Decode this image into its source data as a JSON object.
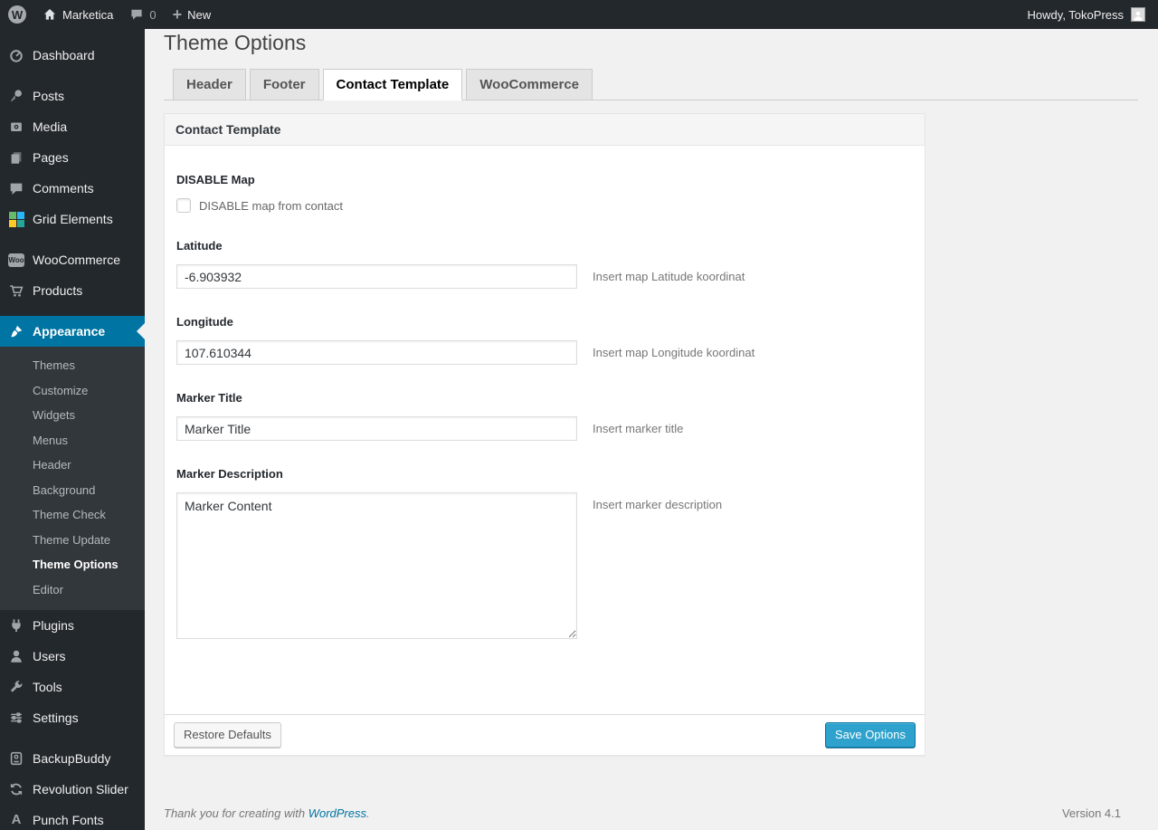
{
  "admin_bar": {
    "site_name": "Marketica",
    "comments_count": "0",
    "new_label": "New",
    "howdy": "Howdy, TokoPress"
  },
  "sidebar": {
    "items": [
      {
        "label": "Dashboard",
        "icon": "dashboard-icon"
      },
      {
        "label": "Posts",
        "icon": "pushpin-icon",
        "separator_before": true
      },
      {
        "label": "Media",
        "icon": "media-icon"
      },
      {
        "label": "Pages",
        "icon": "pages-icon"
      },
      {
        "label": "Comments",
        "icon": "comments-icon"
      },
      {
        "label": "Grid Elements",
        "icon": "grid-elements-icon"
      },
      {
        "label": "WooCommerce",
        "icon": "woocommerce-icon",
        "separator_before": true
      },
      {
        "label": "Products",
        "icon": "cart-icon"
      },
      {
        "label": "Appearance",
        "icon": "brush-icon",
        "active": true,
        "separator_before": true,
        "submenu": [
          {
            "label": "Themes"
          },
          {
            "label": "Customize"
          },
          {
            "label": "Widgets"
          },
          {
            "label": "Menus"
          },
          {
            "label": "Header"
          },
          {
            "label": "Background"
          },
          {
            "label": "Theme Check"
          },
          {
            "label": "Theme Update"
          },
          {
            "label": "Theme Options",
            "current": true
          },
          {
            "label": "Editor"
          }
        ]
      },
      {
        "label": "Plugins",
        "icon": "plug-icon"
      },
      {
        "label": "Users",
        "icon": "users-icon"
      },
      {
        "label": "Tools",
        "icon": "wrench-icon"
      },
      {
        "label": "Settings",
        "icon": "settings-icon"
      },
      {
        "label": "BackupBuddy",
        "icon": "backup-icon",
        "separator_before": true
      },
      {
        "label": "Revolution Slider",
        "icon": "refresh-icon"
      },
      {
        "label": "Punch Fonts",
        "icon": "font-a-icon"
      }
    ]
  },
  "page": {
    "title": "Theme Options",
    "tabs": [
      {
        "label": "Header",
        "active": false
      },
      {
        "label": "Footer",
        "active": false
      },
      {
        "label": "Contact Template",
        "active": true
      },
      {
        "label": "WooCommerce",
        "active": false
      }
    ],
    "panel": {
      "title": "Contact Template",
      "fields": [
        {
          "type": "checkbox",
          "label": "DISABLE Map",
          "checkbox_label": "DISABLE map from contact",
          "checked": false
        },
        {
          "type": "text",
          "label": "Latitude",
          "value": "-6.903932",
          "help": "Insert map Latitude koordinat"
        },
        {
          "type": "text",
          "label": "Longitude",
          "value": "107.610344",
          "help": "Insert map Longitude koordinat"
        },
        {
          "type": "text",
          "label": "Marker Title",
          "value": "Marker Title",
          "help": "Insert marker title"
        },
        {
          "type": "textarea",
          "label": "Marker Description",
          "value": "Marker Content",
          "help": "Insert marker description"
        }
      ],
      "restore_button": "Restore Defaults",
      "save_button": "Save Options"
    },
    "footer": {
      "thanks_prefix": "Thank you for creating with ",
      "link_text": "WordPress",
      "thanks_suffix": ".",
      "version": "Version 4.1"
    }
  },
  "colors": {
    "admin_bar_bg": "#23282d",
    "sidebar_bg": "#23282d",
    "submenu_bg": "#32373c",
    "active_item_bg": "#0074a2",
    "primary_button_bg": "#2ea2cc",
    "primary_button_border": "#0074a2",
    "page_bg": "#f1f1f1",
    "link": "#0074a2"
  }
}
